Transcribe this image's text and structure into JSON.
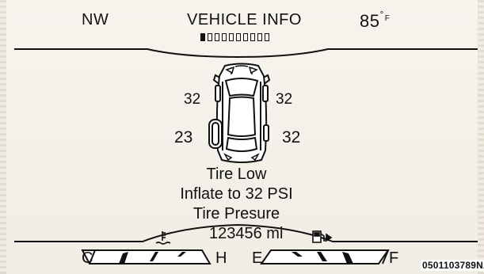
{
  "header": {
    "compass": "NW",
    "title": "VEHICLE INFO",
    "temperature": "85",
    "temperature_unit": "F",
    "page_indicator": {
      "total_pages": 10,
      "current_page": 1
    }
  },
  "tires": {
    "front_left": "32",
    "front_right": "32",
    "rear_left": "23",
    "rear_right": "32"
  },
  "message": {
    "line1": "Tire Low",
    "line2": "Inflate to 32 PSI",
    "line3": "Tire Presure"
  },
  "footer": {
    "odometer": "123456 mi",
    "temp_gauge": {
      "low": "C",
      "high": "H"
    },
    "fuel_gauge": {
      "empty": "E",
      "full": "F"
    },
    "icons": {
      "temp": "coolant-temperature-icon",
      "fuel": "fuel-pump-icon"
    }
  },
  "figure_code": "0501103789NA"
}
